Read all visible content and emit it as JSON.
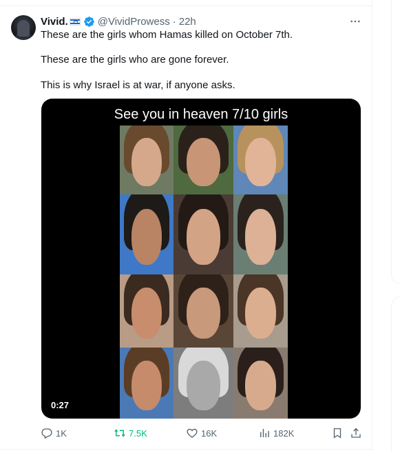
{
  "tweet": {
    "display_name": "Vivid.",
    "handle": "@VividProwess",
    "separator": "·",
    "time": "22h",
    "lines": [
      "These are the girls whom Hamas killed on October 7th.",
      "These are the girls who are gone forever.",
      "This is why Israel is at war, if anyone asks."
    ],
    "media": {
      "title": "See you in heaven 7/10 girls",
      "duration": "0:27"
    },
    "actions": {
      "replies": "1K",
      "reposts": "7.5K",
      "likes": "16K",
      "views": "182K"
    }
  },
  "colors": {
    "text": "#0f1419",
    "muted": "#536471",
    "verified_blue": "#1d9bf0",
    "repost_green": "#00ba7c",
    "flag_blue": "#1f63c6"
  },
  "icons": [
    "verified-icon",
    "israel-flag-icon",
    "more-icon",
    "reply-icon",
    "repost-icon",
    "like-icon",
    "views-icon",
    "bookmark-icon",
    "share-icon"
  ]
}
